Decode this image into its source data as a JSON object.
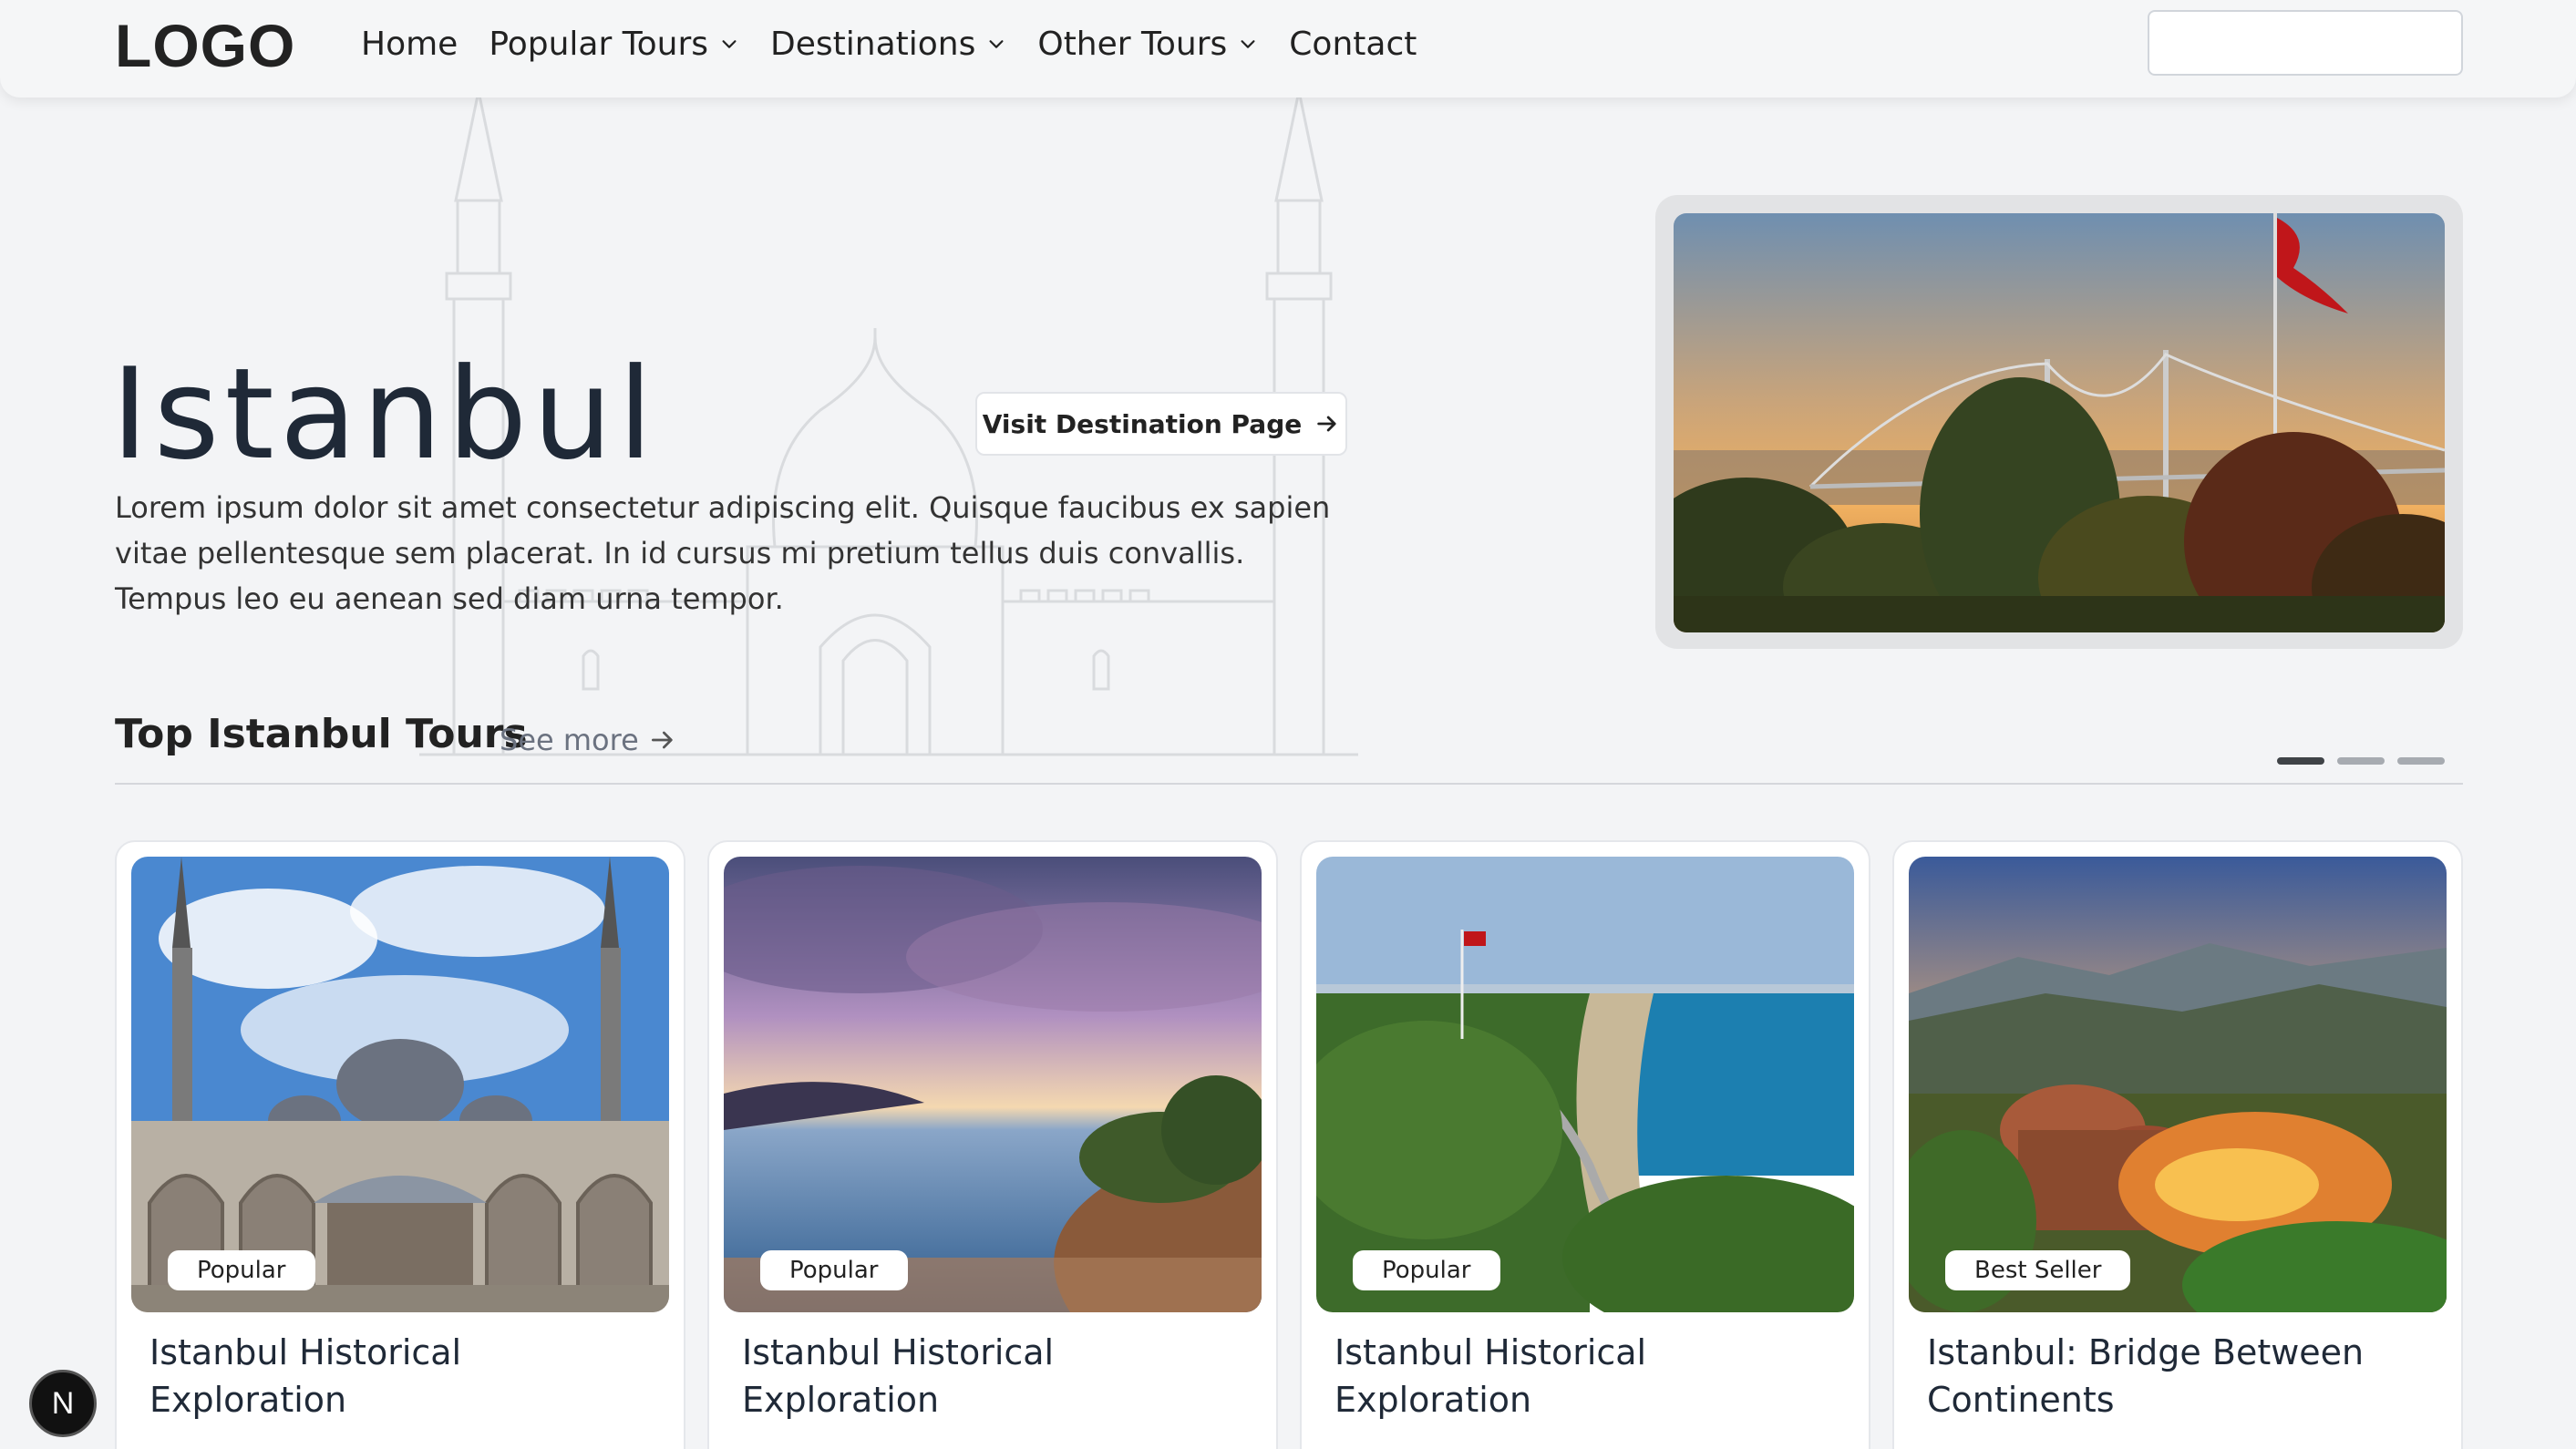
{
  "header": {
    "logo": "LOGO",
    "nav": [
      {
        "label": "Home",
        "has_dropdown": false
      },
      {
        "label": "Popular Tours",
        "has_dropdown": true
      },
      {
        "label": "Destinations",
        "has_dropdown": true
      },
      {
        "label": "Other Tours",
        "has_dropdown": true
      },
      {
        "label": "Contact",
        "has_dropdown": false
      }
    ],
    "search": {
      "value": "",
      "placeholder": ""
    }
  },
  "hero": {
    "title": "Istanbul",
    "visit_button": "Visit Destination Page",
    "description": "Lorem ipsum dolor sit amet consectetur adipiscing elit. Quisque faucibus ex sapien vitae pellentesque sem placerat. In id cursus mi pretium tellus duis convallis. Tempus leo eu aenean sed diam urna tempor."
  },
  "carousel": {
    "slide_count": 3,
    "active_index": 0
  },
  "section": {
    "title": "Top Istanbul Tours",
    "see_more": "See more"
  },
  "cards": [
    {
      "badge": "Popular",
      "title": "Istanbul Historical Exploration"
    },
    {
      "badge": "Popular",
      "title": "Istanbul Historical Exploration"
    },
    {
      "badge": "Popular",
      "title": "Istanbul Historical Exploration"
    },
    {
      "badge": "Best Seller",
      "title": "Istanbul: Bridge Between Continents"
    }
  ],
  "dev_badge": "N",
  "icons": {
    "dropdown": "chevron-down-icon",
    "visit_arrow": "arrow-right-icon",
    "see_more_arrow": "arrow-right-icon",
    "carousel_prev": "chevron-left-icon",
    "carousel_next": "chevron-right-icon"
  }
}
